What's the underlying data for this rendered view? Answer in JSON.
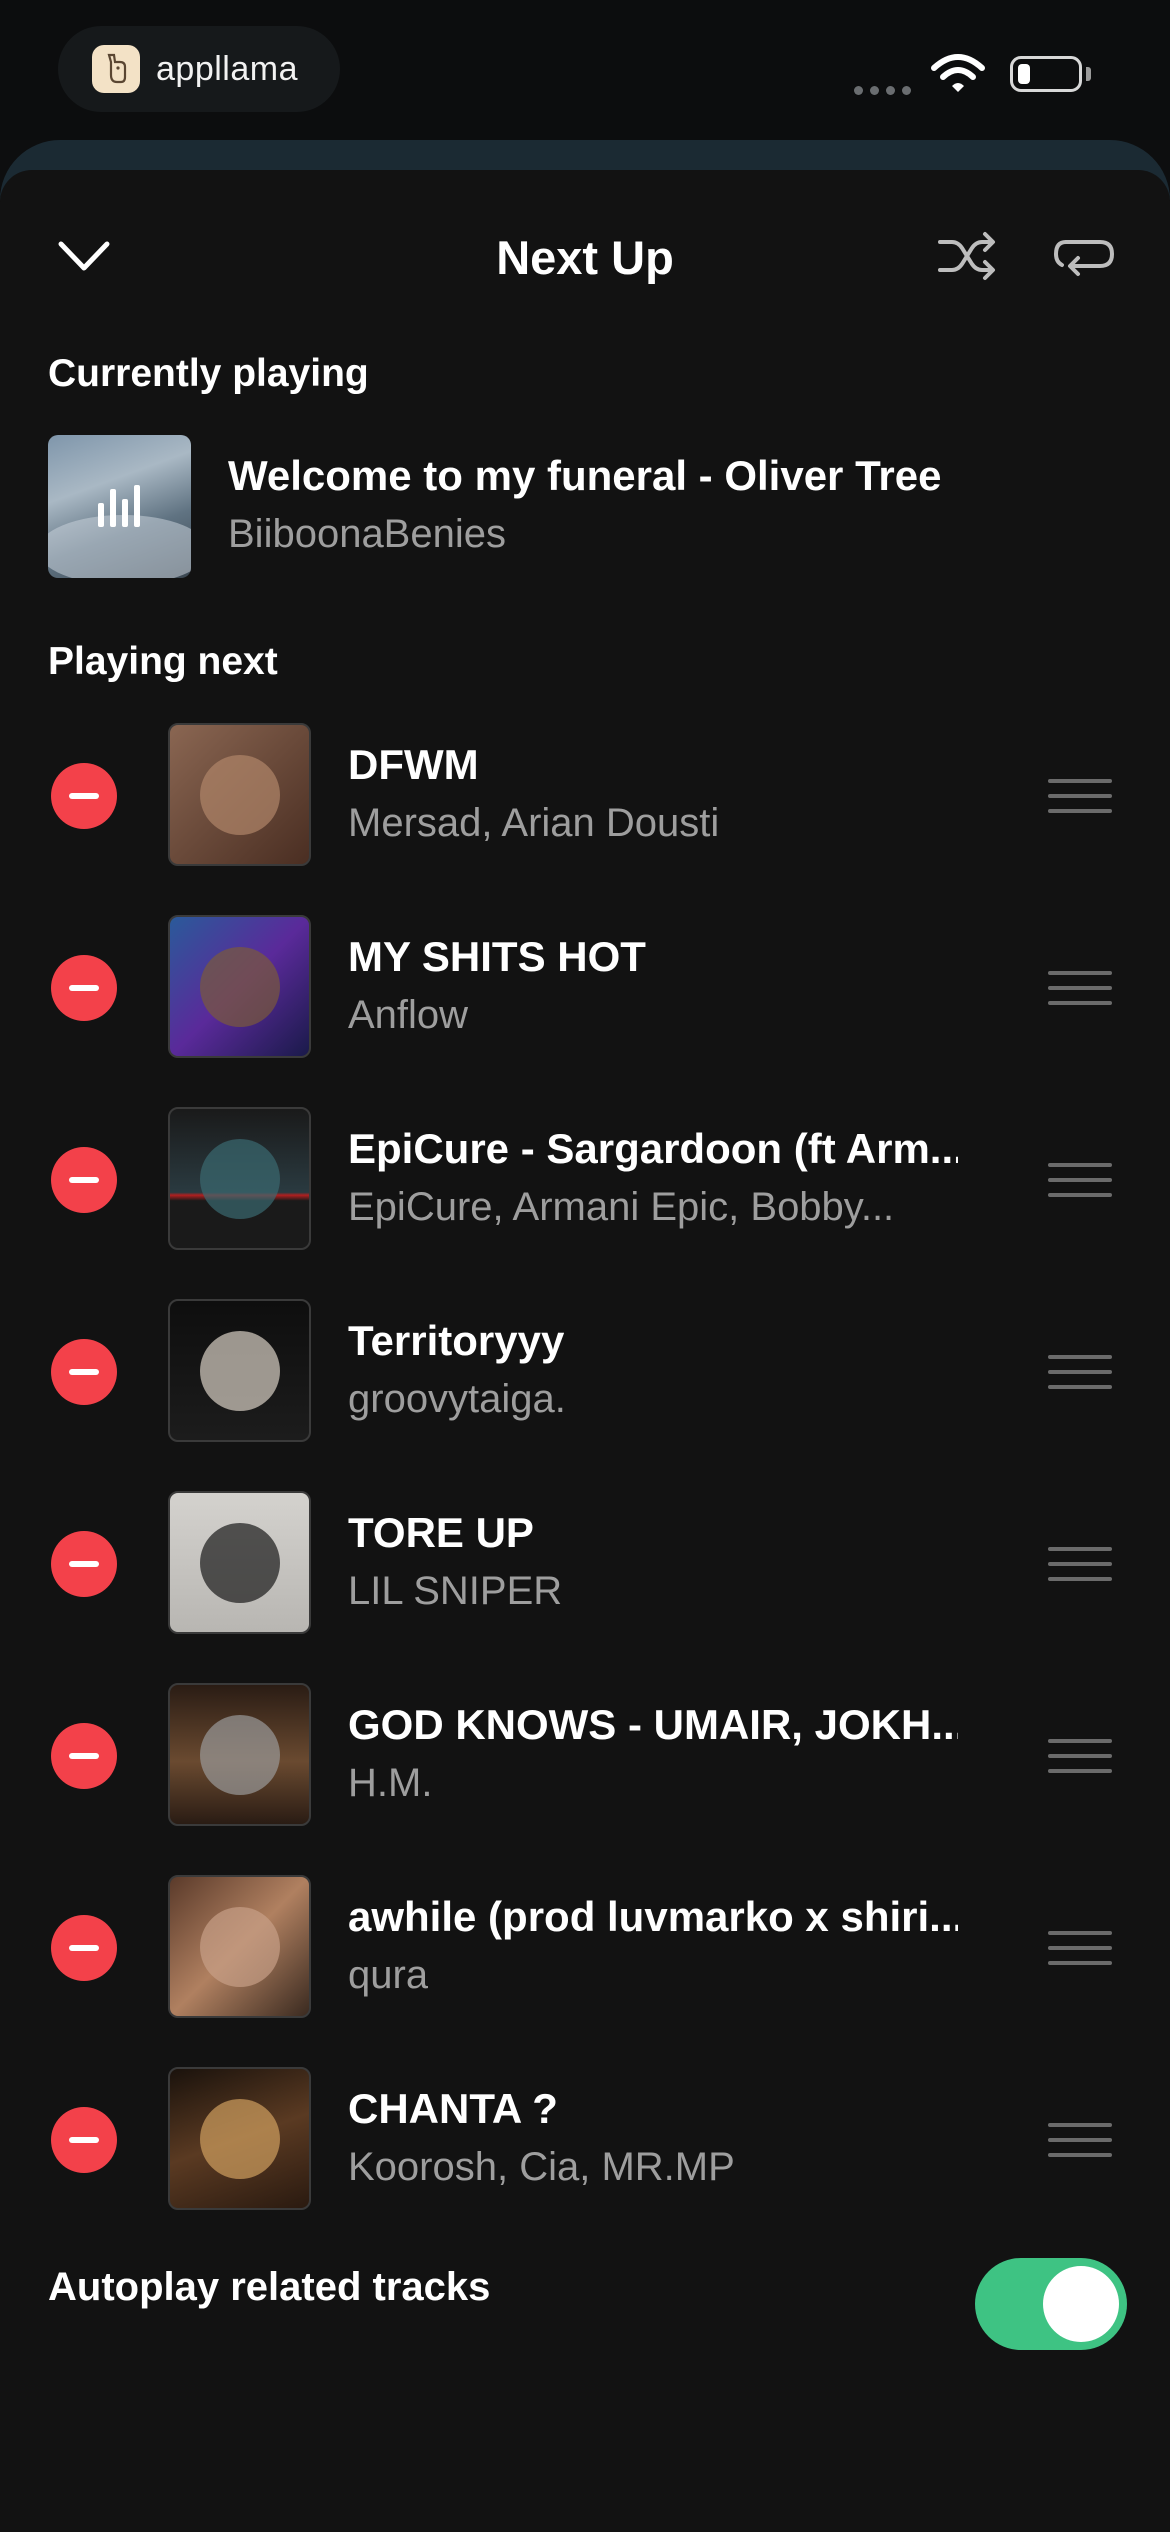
{
  "status_bar": {
    "app_name": "appllama",
    "icons": [
      "signal-dots-icon",
      "wifi-icon",
      "battery-icon"
    ]
  },
  "header": {
    "title": "Next Up",
    "collapse_icon": "chevron-down-icon",
    "shuffle_icon": "shuffle-icon",
    "repeat_icon": "repeat-icon"
  },
  "now_playing": {
    "label": "Currently playing",
    "title": "Welcome to my funeral - Oliver Tree",
    "artist": "BiiboonaBenies",
    "indicator_icon": "equalizer-icon"
  },
  "queue": {
    "label": "Playing next",
    "tracks": [
      {
        "title": "DFWM",
        "artist": "Mersad, Arian Dousti",
        "art_color": "#6b4a3a"
      },
      {
        "title": "MY SHITS HOT",
        "artist": "Anflow",
        "art_color": "#3b2a7a"
      },
      {
        "title": "EpiCure - Sargardoon (ft Arm...",
        "artist": "EpiCure, Armani Epic, Bobby...",
        "art_color": "#1e2a30"
      },
      {
        "title": "Territoryyy",
        "artist": "groovytaiga.",
        "art_color": "#151515"
      },
      {
        "title": "TORE UP",
        "artist": "LIL SNIPER",
        "art_color": "#c8c6c2"
      },
      {
        "title": "GOD KNOWS - UMAIR, JOKH...",
        "artist": "H.M.",
        "art_color": "#3a2a22"
      },
      {
        "title": "awhile (prod luvmarko x shiri...",
        "artist": "qura",
        "art_color": "#9a6a52"
      },
      {
        "title": "CHANTA ?",
        "artist": "Koorosh, Cia, MR.MP",
        "art_color": "#4a3020"
      }
    ]
  },
  "autoplay": {
    "label": "Autoplay related tracks",
    "enabled": true,
    "accent_color": "#3ec383"
  },
  "colors": {
    "remove_button": "#f3414a",
    "background": "#121212",
    "secondary_text": "#9e9e9e"
  }
}
